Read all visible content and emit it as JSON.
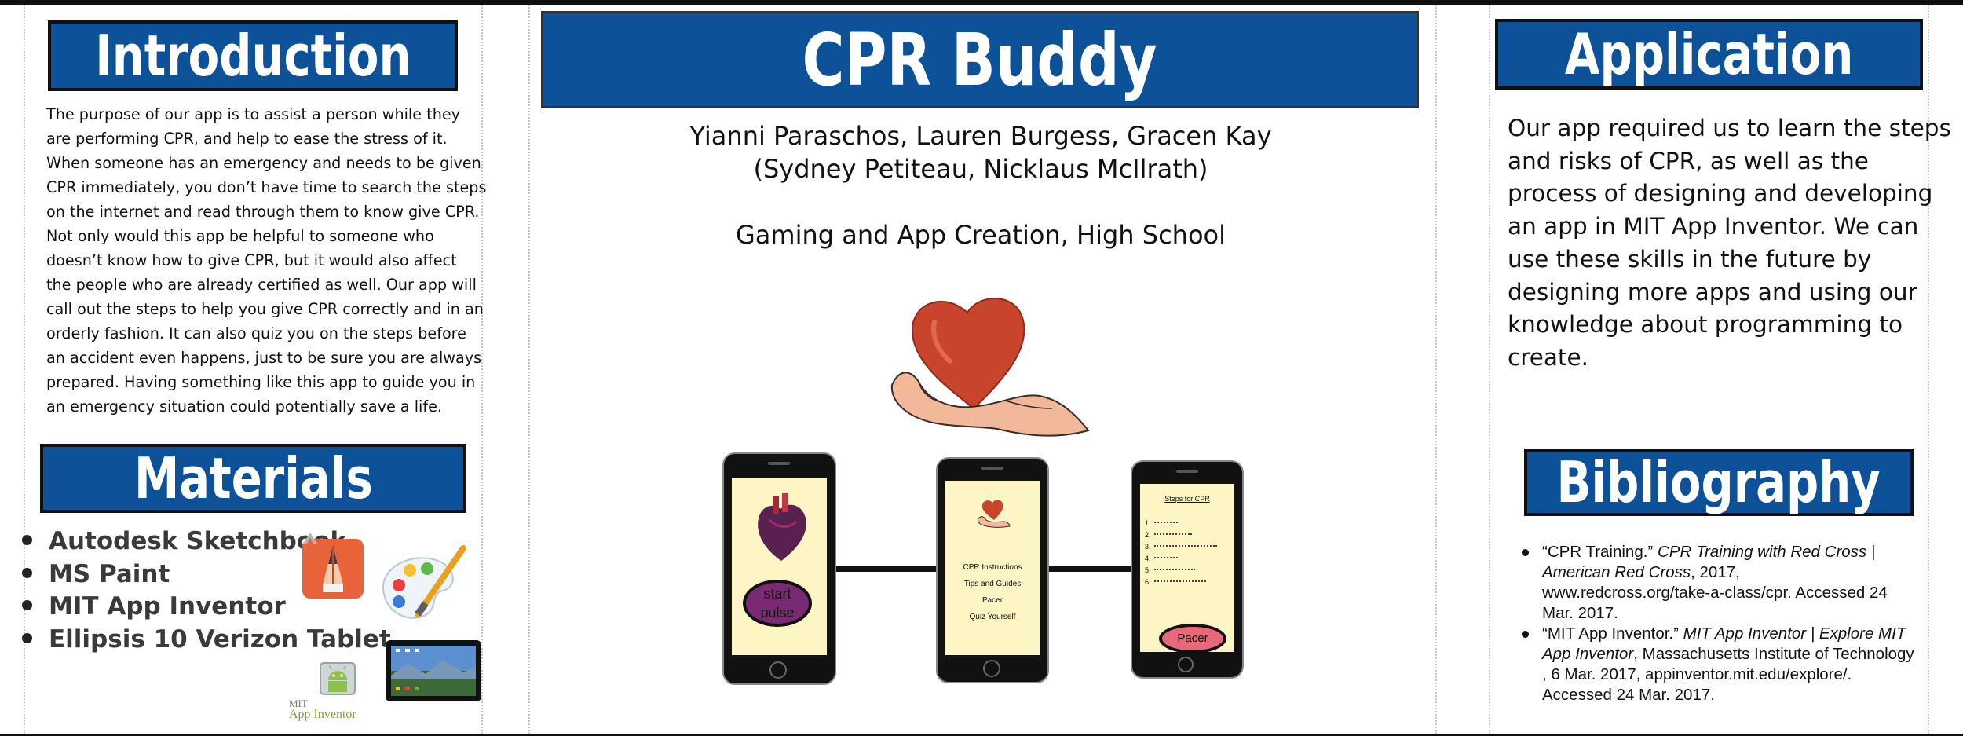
{
  "poster": {
    "title": "CPR Buddy",
    "authors_line1": "Yianni Paraschos, Lauren Burgess, Gracen Kay",
    "authors_line2": "(Sydney Petiteau, Nicklaus McIlrath)",
    "category": "Gaming and App Creation, High School"
  },
  "introduction": {
    "heading": "Introduction",
    "lines": [
      "The purpose of our app is to assist a person while they",
      "are performing CPR, and help to ease the stress of it.",
      "When someone has an emergency and needs to be given",
      "CPR immediately, you don’t have time to search the steps",
      "on the internet and read through them to know give CPR.",
      "Not only would this app be helpful to someone who",
      "doesn’t know how to give CPR, but it would also affect",
      "the people who are already certified as well. Our app will",
      "call out the steps to help you give CPR correctly and in an",
      "orderly fashion. It can also quiz you on the steps before",
      "an accident even happens, just to be sure you are always",
      "prepared. Having something like this app to guide you in",
      "an emergency situation could potentially save a life."
    ]
  },
  "materials": {
    "heading": "Materials",
    "items": [
      "Autodesk Sketchbook",
      "MS Paint",
      "MIT App Inventor",
      "Ellipsis 10 Verizon Tablet"
    ],
    "logo_text_top": "MIT",
    "logo_text_bottom": "App Inventor"
  },
  "application": {
    "heading": "Application",
    "lines": [
      "Our app required us to learn the steps",
      "and risks of CPR, as well as the",
      "process of designing and developing",
      "an app in MIT App Inventor. We can",
      "use these skills in the future by",
      "designing more apps and using our",
      "knowledge about programming to",
      "create."
    ]
  },
  "bibliography": {
    "heading": "Bibliography",
    "entries": [
      {
        "lines": [
          [
            {
              "t": "“CPR Training.” ",
              "i": false
            },
            {
              "t": "CPR Training with Red Cross |",
              "i": true
            }
          ],
          [
            {
              "t": "American Red Cross",
              "i": true
            },
            {
              "t": ", 2017,",
              "i": false
            }
          ],
          [
            {
              "t": "www.redcross.org/take-a-class/cpr. Accessed 24",
              "i": false
            }
          ],
          [
            {
              "t": "Mar. 2017.",
              "i": false
            }
          ]
        ]
      },
      {
        "lines": [
          [
            {
              "t": "“MIT App Inventor.” ",
              "i": false
            },
            {
              "t": "MIT App Inventor | Explore MIT",
              "i": true
            }
          ],
          [
            {
              "t": "App Inventor",
              "i": true
            },
            {
              "t": ", Massachusetts Institute of Technology",
              "i": false
            }
          ],
          [
            {
              "t": ", 6 Mar. 2017, appinventor.mit.edu/explore/.",
              "i": false
            }
          ],
          [
            {
              "t": "Accessed 24 Mar. 2017.",
              "i": false
            }
          ]
        ]
      }
    ]
  },
  "phones": {
    "phone1": {
      "button": [
        "start",
        "pulse"
      ]
    },
    "phone2": {
      "menu": [
        "CPR Instructions",
        "Tips and Guides",
        "Pacer",
        "Quiz Yourself"
      ]
    },
    "phone3": {
      "header": "Steps for CPR",
      "steps": [
        "1.",
        "2.",
        "3.",
        "4.",
        "5.",
        "6."
      ],
      "button": "Pacer"
    }
  },
  "colors": {
    "banner_blue": "#0d5299",
    "heart_red": "#c9442c",
    "phone_screen": "#fdf6c4",
    "button_pink": "#e86a7a",
    "button_purple": "#7a2a72"
  }
}
